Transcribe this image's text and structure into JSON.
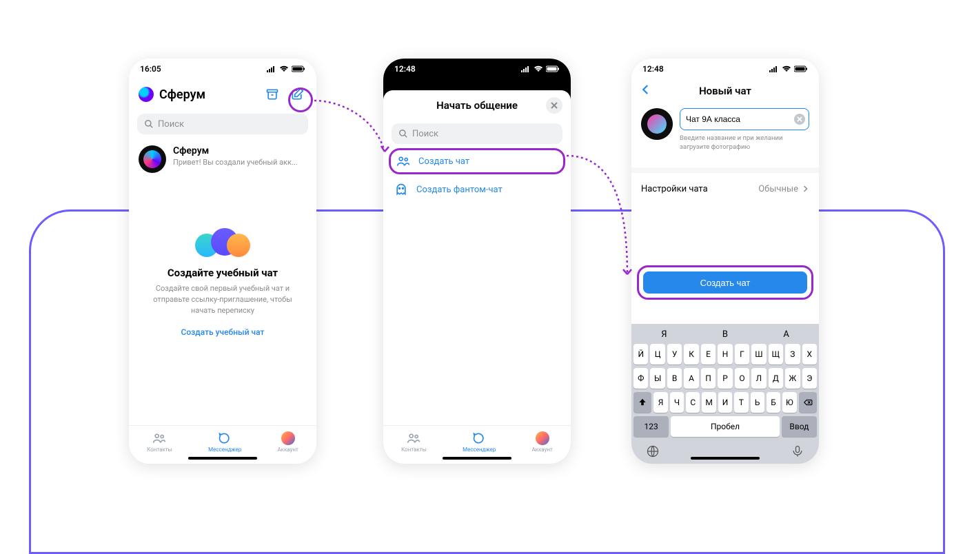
{
  "phone1": {
    "time": "16:05",
    "app_title": "Сферум",
    "search_placeholder": "Поиск",
    "chat": {
      "name": "Сферум",
      "preview": "Привет! Вы создали учебный акк..."
    },
    "empty": {
      "title": "Создайте учебный чат",
      "subtitle": "Создайте свой первый учебный чат и отправьте ссылку-приглашение, чтобы начать переписку",
      "link": "Создать учебный чат"
    },
    "tabs": {
      "contacts": "Контакты",
      "messenger": "Мессенджер",
      "account": "Аккаунт"
    }
  },
  "phone2": {
    "time": "12:48",
    "sheet_title": "Начать общение",
    "search_placeholder": "Поиск",
    "option_create_chat": "Создать чат",
    "option_create_phantom": "Создать фантом-чат",
    "tabs": {
      "contacts": "Контакты",
      "messenger": "Мессенджер",
      "account": "Аккаунт"
    }
  },
  "phone3": {
    "time": "12:48",
    "title": "Новый чат",
    "input_value": "Чат 9А класса",
    "hint": "Введите название и при желании загрузите фотографию",
    "settings_label": "Настройки чата",
    "settings_value": "Обычные",
    "create_button": "Создать чат",
    "keyboard": {
      "suggestions": [
        "Я",
        "В",
        "А"
      ],
      "row1": [
        "Й",
        "Ц",
        "У",
        "К",
        "Е",
        "Н",
        "Г",
        "Ш",
        "Щ",
        "З",
        "Х"
      ],
      "row2": [
        "Ф",
        "Ы",
        "В",
        "А",
        "П",
        "Р",
        "О",
        "Л",
        "Д",
        "Ж",
        "Э"
      ],
      "row3_mid": [
        "Я",
        "Ч",
        "С",
        "М",
        "И",
        "Т",
        "Ь",
        "Б",
        "Ю"
      ],
      "numbers_key": "123",
      "space_key": "Пробел",
      "enter_key": "Ввод"
    }
  }
}
